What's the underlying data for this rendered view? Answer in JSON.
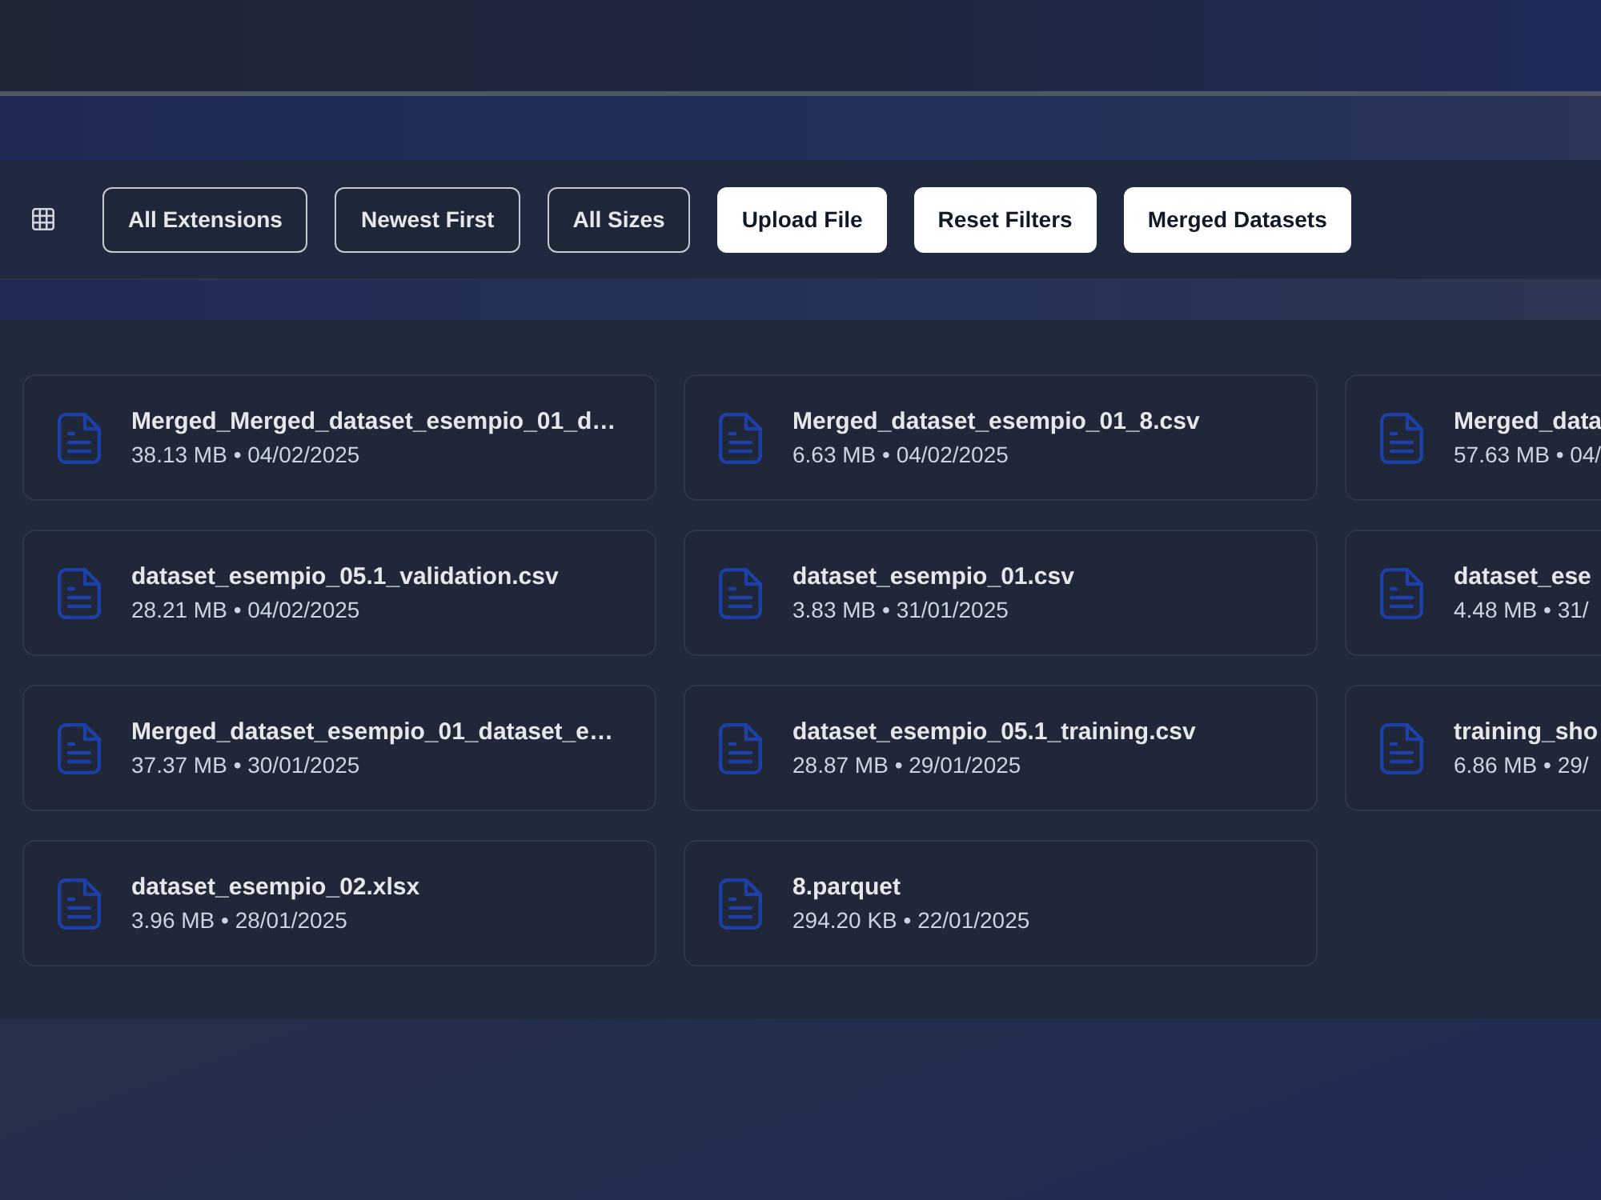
{
  "toolbar": {
    "buttons": [
      {
        "label": "All Extensions",
        "kind": "filter"
      },
      {
        "label": "Newest First",
        "kind": "filter"
      },
      {
        "label": "All Sizes",
        "kind": "filter"
      },
      {
        "label": "Upload File",
        "kind": "action"
      },
      {
        "label": "Reset Filters",
        "kind": "action"
      },
      {
        "label": "Merged Datasets",
        "kind": "action"
      }
    ]
  },
  "files": [
    {
      "name": "Merged_Merged_dataset_esempio_01_d…",
      "meta": "38.13 MB • 04/02/2025"
    },
    {
      "name": "Merged_dataset_esempio_01_8.csv",
      "meta": "6.63 MB • 04/02/2025"
    },
    {
      "name": "Merged_data",
      "meta": "57.63 MB • 04/"
    },
    {
      "name": "dataset_esempio_05.1_validation.csv",
      "meta": "28.21 MB • 04/02/2025"
    },
    {
      "name": "dataset_esempio_01.csv",
      "meta": "3.83 MB • 31/01/2025"
    },
    {
      "name": "dataset_ese",
      "meta": "4.48 MB • 31/"
    },
    {
      "name": "Merged_dataset_esempio_01_dataset_e…",
      "meta": "37.37 MB • 30/01/2025"
    },
    {
      "name": "dataset_esempio_05.1_training.csv",
      "meta": "28.87 MB • 29/01/2025"
    },
    {
      "name": "training_sho",
      "meta": "6.86 MB • 29/"
    },
    {
      "name": "dataset_esempio_02.xlsx",
      "meta": "3.96 MB • 28/01/2025"
    },
    {
      "name": "8.parquet",
      "meta": "294.20 KB • 22/01/2025"
    }
  ]
}
